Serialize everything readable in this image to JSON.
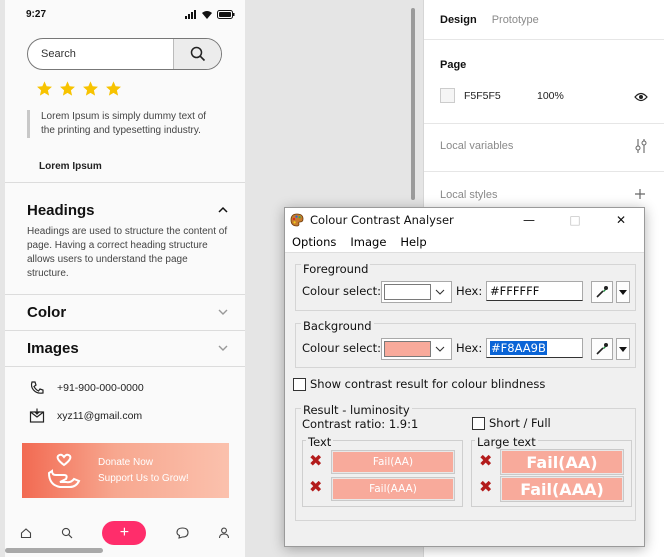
{
  "phone": {
    "time": "9:27",
    "search_placeholder": "Search",
    "rating": 4,
    "quote": "Lorem Ipsum is simply dummy text of the printing and typesetting industry.",
    "author": "Lorem Ipsum",
    "accordion": [
      {
        "title": "Headings",
        "body": "Headings are used to structure the content of page. Having a correct heading structure allows users to understand the page structure.",
        "expanded": true
      },
      {
        "title": "Color",
        "expanded": false
      },
      {
        "title": "Images",
        "expanded": false
      }
    ],
    "phone_number": "+91-900-000-0000",
    "email": "xyz11@gmail.com",
    "banner": {
      "title": "Donate Now",
      "subtitle": "Support Us to Grow!"
    },
    "colors": {
      "accent": "#ff2d6b",
      "banner_start": "#f26a52",
      "star": "#f7c300"
    }
  },
  "panel": {
    "tabs": [
      "Design",
      "Prototype"
    ],
    "page_title": "Page",
    "page_color": "F5F5F5",
    "page_opacity": "100%",
    "local_variables": "Local variables",
    "local_styles": "Local styles"
  },
  "cca": {
    "title": "Colour Contrast Analyser",
    "menu": {
      "options": "Options",
      "image": "Image",
      "help": "Help"
    },
    "foreground": {
      "title": "Foreground",
      "colour_select": "Colour select:",
      "hex_label": "Hex:",
      "hex": "#FFFFFF",
      "swatch": "#FFFFFF"
    },
    "background": {
      "title": "Background",
      "colour_select": "Colour select:",
      "hex_label": "Hex:",
      "hex": "#F8AA9B",
      "swatch": "#F8AA9B"
    },
    "blindness_label": "Show contrast result for colour blindness",
    "result_title": "Result - luminosity",
    "contrast_ratio": "Contrast ratio: 1.9:1",
    "short_full": "Short / Full",
    "text_group": "Text",
    "large_text_group": "Large text",
    "text_results": [
      "Fail(AA)",
      "Fail(AAA)"
    ],
    "large_text_results": [
      "Fail(AA)",
      "Fail(AAA)"
    ]
  }
}
